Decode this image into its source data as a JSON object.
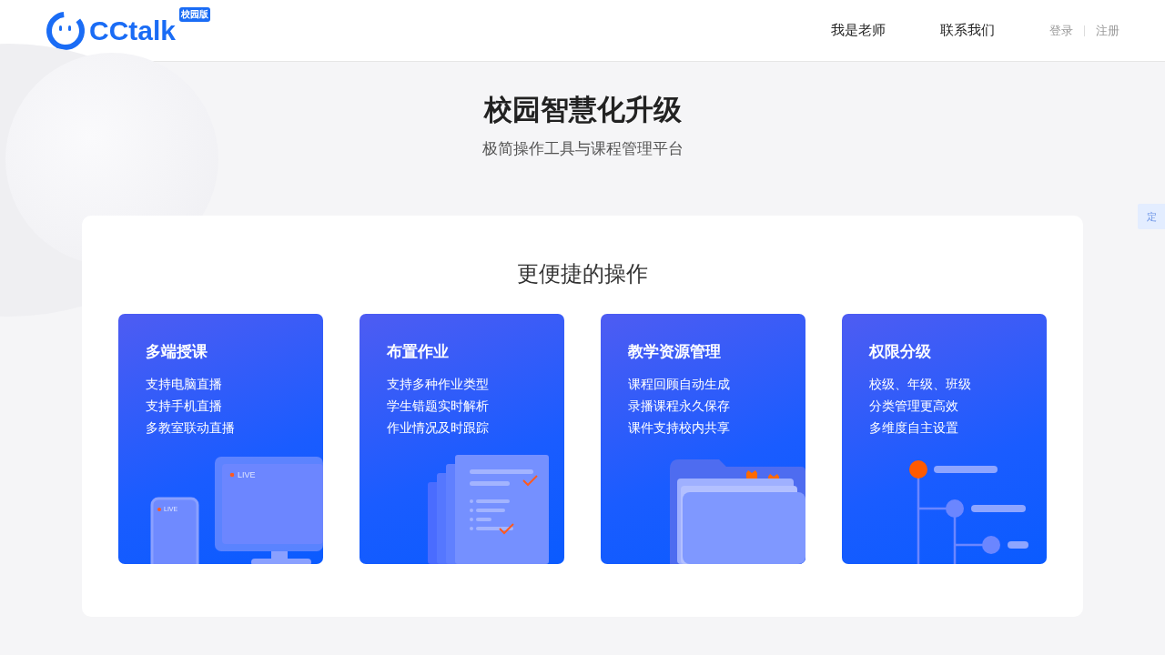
{
  "header": {
    "logo": {
      "name": "CCtalk",
      "badge": "校园版"
    },
    "nav": [
      {
        "label": "我是老师"
      },
      {
        "label": "联系我们"
      }
    ],
    "auth": [
      "登录",
      "注册"
    ]
  },
  "hero": {
    "title": "校园智慧化升级",
    "subtitle": "极简操作工具与课程管理平台"
  },
  "side_tab": "定",
  "panel": {
    "heading": "更便捷的操作",
    "cards": [
      {
        "title": "多端授课",
        "lines": [
          "支持电脑直播",
          "支持手机直播",
          "多教室联动直播"
        ],
        "kind": "devices",
        "labels": [
          "LIVE",
          "LIVE"
        ]
      },
      {
        "title": "布置作业",
        "lines": [
          "支持多种作业类型",
          "学生错题实时解析",
          "作业情况及时跟踪"
        ],
        "kind": "documents"
      },
      {
        "title": "教学资源管理",
        "lines": [
          "课程回顾自动生成",
          "录播课程永久保存",
          "课件支持校内共享"
        ],
        "kind": "folder"
      },
      {
        "title": "权限分级",
        "lines": [
          "校级、年级、班级",
          "分类管理更高效",
          "多维度自主设置"
        ],
        "kind": "tree"
      }
    ]
  }
}
